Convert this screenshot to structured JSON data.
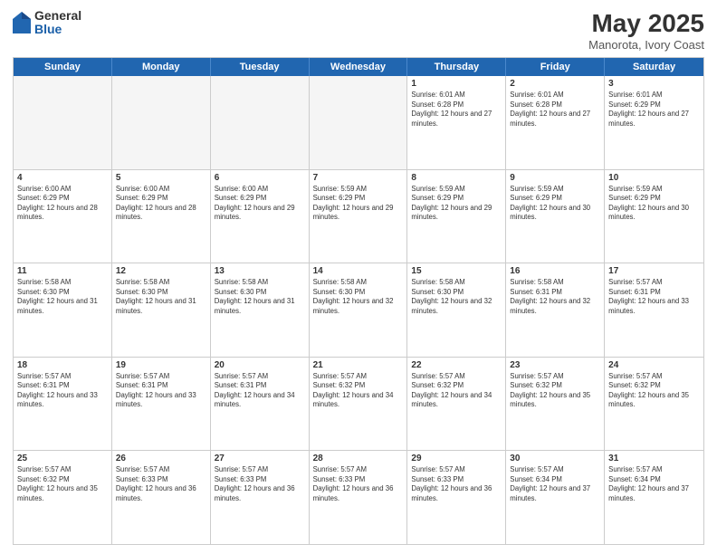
{
  "logo": {
    "general": "General",
    "blue": "Blue"
  },
  "title": {
    "month": "May 2025",
    "location": "Manorota, Ivory Coast"
  },
  "header": {
    "days": [
      "Sunday",
      "Monday",
      "Tuesday",
      "Wednesday",
      "Thursday",
      "Friday",
      "Saturday"
    ]
  },
  "weeks": [
    [
      {
        "day": "",
        "empty": true
      },
      {
        "day": "",
        "empty": true
      },
      {
        "day": "",
        "empty": true
      },
      {
        "day": "",
        "empty": true
      },
      {
        "day": "1",
        "sunrise": "Sunrise: 6:01 AM",
        "sunset": "Sunset: 6:28 PM",
        "daylight": "Daylight: 12 hours and 27 minutes."
      },
      {
        "day": "2",
        "sunrise": "Sunrise: 6:01 AM",
        "sunset": "Sunset: 6:28 PM",
        "daylight": "Daylight: 12 hours and 27 minutes."
      },
      {
        "day": "3",
        "sunrise": "Sunrise: 6:01 AM",
        "sunset": "Sunset: 6:29 PM",
        "daylight": "Daylight: 12 hours and 27 minutes."
      }
    ],
    [
      {
        "day": "4",
        "sunrise": "Sunrise: 6:00 AM",
        "sunset": "Sunset: 6:29 PM",
        "daylight": "Daylight: 12 hours and 28 minutes."
      },
      {
        "day": "5",
        "sunrise": "Sunrise: 6:00 AM",
        "sunset": "Sunset: 6:29 PM",
        "daylight": "Daylight: 12 hours and 28 minutes."
      },
      {
        "day": "6",
        "sunrise": "Sunrise: 6:00 AM",
        "sunset": "Sunset: 6:29 PM",
        "daylight": "Daylight: 12 hours and 29 minutes."
      },
      {
        "day": "7",
        "sunrise": "Sunrise: 5:59 AM",
        "sunset": "Sunset: 6:29 PM",
        "daylight": "Daylight: 12 hours and 29 minutes."
      },
      {
        "day": "8",
        "sunrise": "Sunrise: 5:59 AM",
        "sunset": "Sunset: 6:29 PM",
        "daylight": "Daylight: 12 hours and 29 minutes."
      },
      {
        "day": "9",
        "sunrise": "Sunrise: 5:59 AM",
        "sunset": "Sunset: 6:29 PM",
        "daylight": "Daylight: 12 hours and 30 minutes."
      },
      {
        "day": "10",
        "sunrise": "Sunrise: 5:59 AM",
        "sunset": "Sunset: 6:29 PM",
        "daylight": "Daylight: 12 hours and 30 minutes."
      }
    ],
    [
      {
        "day": "11",
        "sunrise": "Sunrise: 5:58 AM",
        "sunset": "Sunset: 6:30 PM",
        "daylight": "Daylight: 12 hours and 31 minutes."
      },
      {
        "day": "12",
        "sunrise": "Sunrise: 5:58 AM",
        "sunset": "Sunset: 6:30 PM",
        "daylight": "Daylight: 12 hours and 31 minutes."
      },
      {
        "day": "13",
        "sunrise": "Sunrise: 5:58 AM",
        "sunset": "Sunset: 6:30 PM",
        "daylight": "Daylight: 12 hours and 31 minutes."
      },
      {
        "day": "14",
        "sunrise": "Sunrise: 5:58 AM",
        "sunset": "Sunset: 6:30 PM",
        "daylight": "Daylight: 12 hours and 32 minutes."
      },
      {
        "day": "15",
        "sunrise": "Sunrise: 5:58 AM",
        "sunset": "Sunset: 6:30 PM",
        "daylight": "Daylight: 12 hours and 32 minutes."
      },
      {
        "day": "16",
        "sunrise": "Sunrise: 5:58 AM",
        "sunset": "Sunset: 6:31 PM",
        "daylight": "Daylight: 12 hours and 32 minutes."
      },
      {
        "day": "17",
        "sunrise": "Sunrise: 5:57 AM",
        "sunset": "Sunset: 6:31 PM",
        "daylight": "Daylight: 12 hours and 33 minutes."
      }
    ],
    [
      {
        "day": "18",
        "sunrise": "Sunrise: 5:57 AM",
        "sunset": "Sunset: 6:31 PM",
        "daylight": "Daylight: 12 hours and 33 minutes."
      },
      {
        "day": "19",
        "sunrise": "Sunrise: 5:57 AM",
        "sunset": "Sunset: 6:31 PM",
        "daylight": "Daylight: 12 hours and 33 minutes."
      },
      {
        "day": "20",
        "sunrise": "Sunrise: 5:57 AM",
        "sunset": "Sunset: 6:31 PM",
        "daylight": "Daylight: 12 hours and 34 minutes."
      },
      {
        "day": "21",
        "sunrise": "Sunrise: 5:57 AM",
        "sunset": "Sunset: 6:32 PM",
        "daylight": "Daylight: 12 hours and 34 minutes."
      },
      {
        "day": "22",
        "sunrise": "Sunrise: 5:57 AM",
        "sunset": "Sunset: 6:32 PM",
        "daylight": "Daylight: 12 hours and 34 minutes."
      },
      {
        "day": "23",
        "sunrise": "Sunrise: 5:57 AM",
        "sunset": "Sunset: 6:32 PM",
        "daylight": "Daylight: 12 hours and 35 minutes."
      },
      {
        "day": "24",
        "sunrise": "Sunrise: 5:57 AM",
        "sunset": "Sunset: 6:32 PM",
        "daylight": "Daylight: 12 hours and 35 minutes."
      }
    ],
    [
      {
        "day": "25",
        "sunrise": "Sunrise: 5:57 AM",
        "sunset": "Sunset: 6:32 PM",
        "daylight": "Daylight: 12 hours and 35 minutes."
      },
      {
        "day": "26",
        "sunrise": "Sunrise: 5:57 AM",
        "sunset": "Sunset: 6:33 PM",
        "daylight": "Daylight: 12 hours and 36 minutes."
      },
      {
        "day": "27",
        "sunrise": "Sunrise: 5:57 AM",
        "sunset": "Sunset: 6:33 PM",
        "daylight": "Daylight: 12 hours and 36 minutes."
      },
      {
        "day": "28",
        "sunrise": "Sunrise: 5:57 AM",
        "sunset": "Sunset: 6:33 PM",
        "daylight": "Daylight: 12 hours and 36 minutes."
      },
      {
        "day": "29",
        "sunrise": "Sunrise: 5:57 AM",
        "sunset": "Sunset: 6:33 PM",
        "daylight": "Daylight: 12 hours and 36 minutes."
      },
      {
        "day": "30",
        "sunrise": "Sunrise: 5:57 AM",
        "sunset": "Sunset: 6:34 PM",
        "daylight": "Daylight: 12 hours and 37 minutes."
      },
      {
        "day": "31",
        "sunrise": "Sunrise: 5:57 AM",
        "sunset": "Sunset: 6:34 PM",
        "daylight": "Daylight: 12 hours and 37 minutes."
      }
    ]
  ]
}
